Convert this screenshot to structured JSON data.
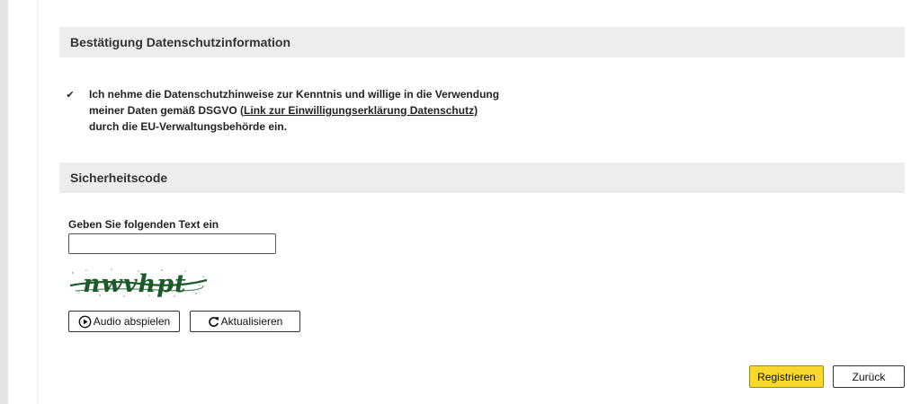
{
  "privacy_section": {
    "title": "Bestätigung Datenschutzinformation",
    "consent_checked": true,
    "consent_text_before": "Ich nehme die Datenschutzhinweise zur Kenntnis und willige in die Verwendung meiner Daten gemäß DSGVO (",
    "consent_link": "Link zur Einwilligungserklärung Datenschutz)",
    "consent_text_after": " durch die EU-Verwaltungsbehörde ein."
  },
  "security_section": {
    "title": "Sicherheitscode",
    "input_label": "Geben Sie folgenden Text ein",
    "input_value": "",
    "captcha_text": "nwvhpt",
    "audio_button": "Audio abspielen",
    "refresh_button": "Aktualisieren"
  },
  "actions": {
    "register_label": "Registrieren",
    "back_label": "Zurück"
  }
}
